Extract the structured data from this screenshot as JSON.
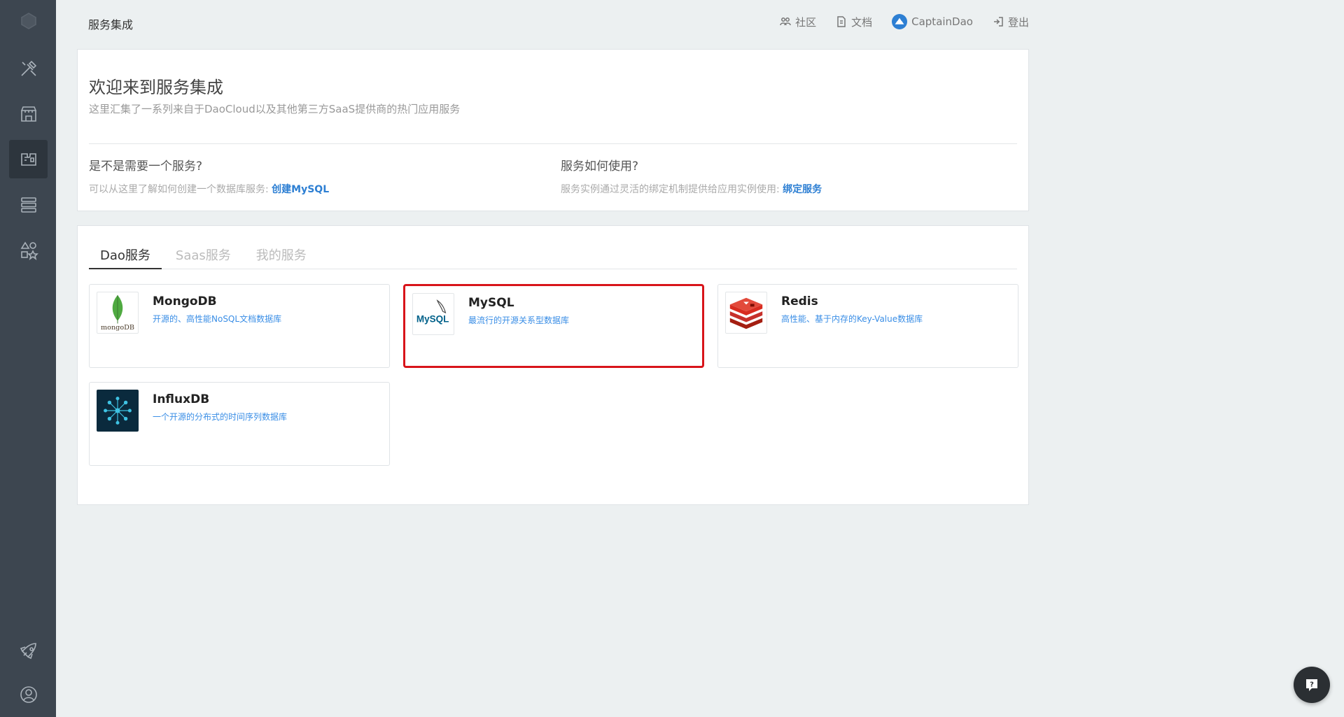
{
  "header": {
    "title": "服务集成",
    "community": "社区",
    "docs": "文档",
    "user": "CaptainDao",
    "logout": "登出"
  },
  "welcome": {
    "title": "欢迎来到服务集成",
    "subtitle": "这里汇集了一系列来自于DaoCloud以及其他第三方SaaS提供商的热门应用服务",
    "left": {
      "heading": "是不是需要一个服务?",
      "text": "可以从这里了解如何创建一个数据库服务: ",
      "link": "创建MySQL"
    },
    "right": {
      "heading": "服务如何使用?",
      "text": "服务实例通过灵活的绑定机制提供给应用实例使用: ",
      "link": "绑定服务"
    }
  },
  "tabs": [
    "Dao服务",
    "Saas服务",
    "我的服务"
  ],
  "services": [
    {
      "name": "MongoDB",
      "desc": "开源的、高性能NoSQL文档数据库",
      "logo_text": "mongoDB"
    },
    {
      "name": "MySQL",
      "desc": "最流行的开源关系型数据库",
      "logo_text": "MySQL"
    },
    {
      "name": "Redis",
      "desc": "高性能、基于内存的Key-Value数据库"
    },
    {
      "name": "InfluxDB",
      "desc": "一个开源的分布式的时间序列数据库"
    }
  ],
  "colors": {
    "sidebar": "#3d4650",
    "accent": "#2d7fd3",
    "selected_border": "#d8141a"
  }
}
